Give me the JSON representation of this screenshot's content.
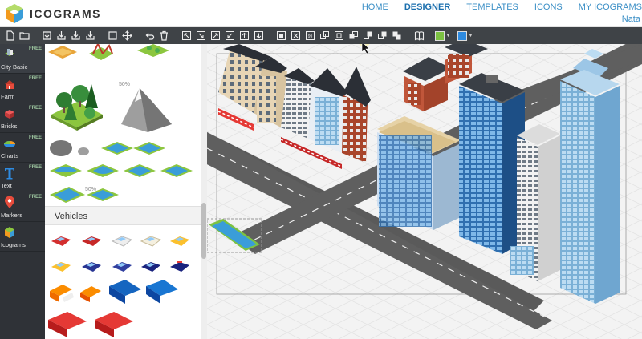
{
  "app": {
    "logo_text": "ICOGRAMS"
  },
  "nav": {
    "items": [
      {
        "label": "HOME",
        "active": false
      },
      {
        "label": "DESIGNER",
        "active": true
      },
      {
        "label": "TEMPLATES",
        "active": false
      },
      {
        "label": "ICONS",
        "active": false
      },
      {
        "label": "MY ICOGRAMS",
        "active": false
      }
    ],
    "user": "Nata"
  },
  "toolbar": {
    "fill_color": "#7cc242",
    "line_color": "#2e8be0",
    "tools": [
      "new-file",
      "open-folder",
      "save",
      "export-svg",
      "export-png",
      "export-jpg",
      "select-rect",
      "move",
      "undo",
      "delete",
      "align-1",
      "align-2",
      "align-3",
      "align-4",
      "align-5",
      "align-6",
      "group",
      "ungroup",
      "duplicate",
      "arrange-1",
      "arrange-2",
      "arrange-3",
      "arrange-4",
      "arrange-5",
      "book",
      "fill-color",
      "line-color"
    ]
  },
  "sidebar": {
    "categories": [
      {
        "label": "City Basic",
        "badge": "FREE",
        "icon": "city-icon"
      },
      {
        "label": "Farm",
        "badge": "FREE",
        "icon": "farm-icon"
      },
      {
        "label": "Bricks",
        "badge": "FREE",
        "icon": "bricks-icon"
      },
      {
        "label": "Charts",
        "badge": "FREE",
        "icon": "charts-icon"
      },
      {
        "label": "Text",
        "badge": "FREE",
        "icon": "text-icon"
      },
      {
        "label": "Markers",
        "badge": "FREE",
        "icon": "markers-icon"
      },
      {
        "label": "Icograms",
        "badge": "",
        "icon": "icograms-icon"
      }
    ]
  },
  "palette": {
    "scale_label_1": "50%",
    "scale_label_2": "50%",
    "section_title": "Vehicles"
  }
}
